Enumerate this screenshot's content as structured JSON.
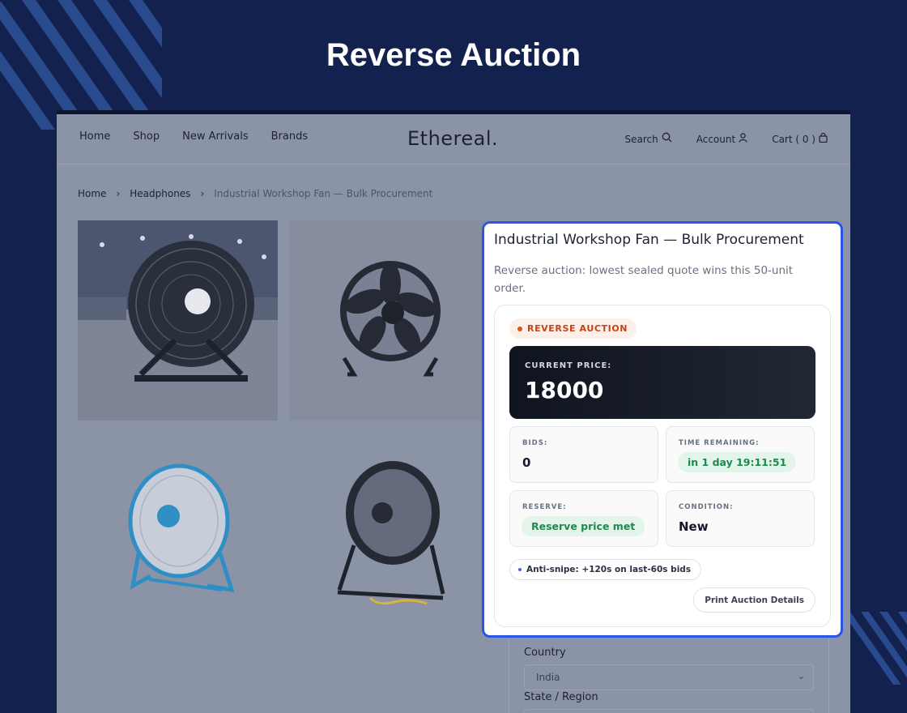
{
  "page_title": "Reverse Auction",
  "nav": {
    "links": [
      "Home",
      "Shop",
      "New Arrivals",
      "Brands"
    ],
    "logo": "Ethereal.",
    "search": "Search",
    "account": "Account",
    "cart": "Cart ( 0 )"
  },
  "breadcrumb": {
    "home": "Home",
    "category": "Headphones",
    "current": "Industrial Workshop Fan — Bulk Procurement"
  },
  "form": {
    "country_label": "Country",
    "country_value": "India",
    "state_label": "State / Region"
  },
  "auction": {
    "title": "Industrial Workshop Fan — Bulk Procurement",
    "description": "Reverse auction: lowest sealed quote wins this 50-unit order.",
    "badge": "REVERSE AUCTION",
    "current_price_label": "CURRENT PRICE:",
    "current_price": "18000",
    "bids_label": "BIDS:",
    "bids": "0",
    "time_label": "TIME REMAINING:",
    "time_remaining": "in 1 day 19:11:51",
    "reserve_label": "RESERVE:",
    "reserve_status": "Reserve price met",
    "condition_label": "CONDITION:",
    "condition": "New",
    "anti_snipe": "Anti-snipe: +120s on last-60s bids",
    "print_button": "Print Auction Details"
  },
  "colors": {
    "background": "#13214f",
    "highlight_border": "#2b55e6",
    "badge_text": "#c0441c",
    "success": "#1e8a4e",
    "fan_blue": "#2f8fc4"
  }
}
